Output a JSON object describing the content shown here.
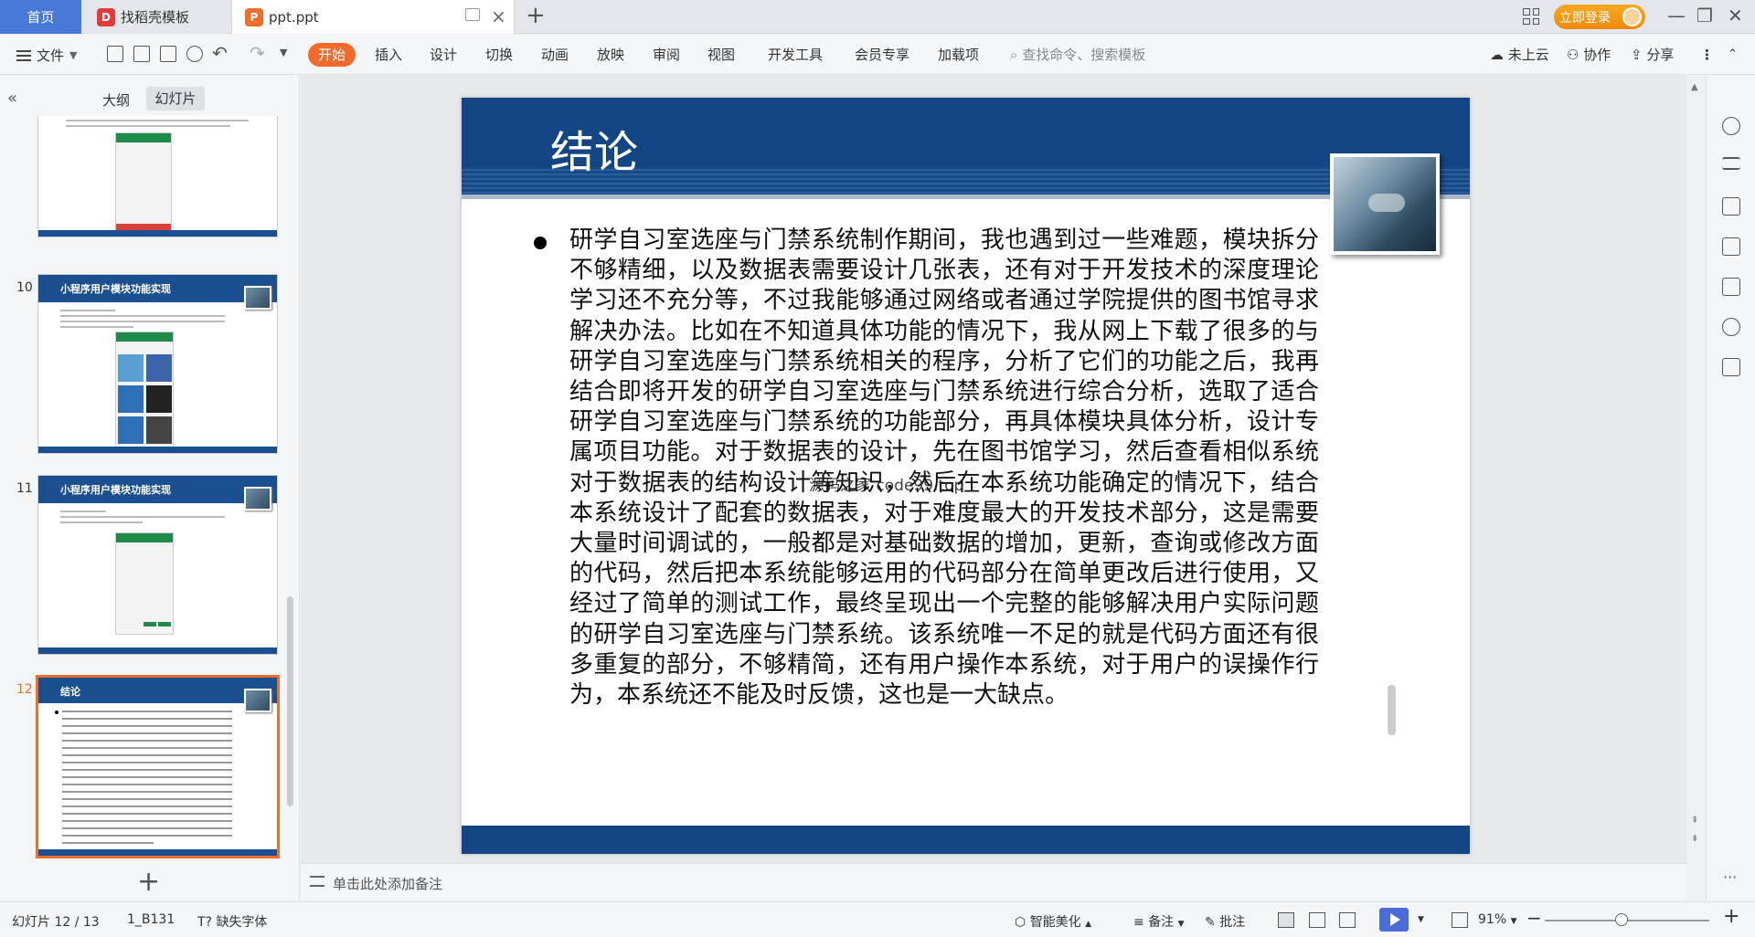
{
  "tabs": {
    "home": "首页",
    "template": "找稻壳模板",
    "document": "ppt.ppt"
  },
  "titlebar": {
    "login": "立即登录"
  },
  "toolbar": {
    "file": "文件",
    "ribbon_tabs": [
      "开始",
      "插入",
      "设计",
      "切换",
      "动画",
      "放映",
      "审阅",
      "视图",
      "开发工具",
      "会员专享",
      "加载项"
    ],
    "search_placeholder": "查找命令、搜索模板",
    "cloud": "未上云",
    "collab": "协作",
    "share": "分享"
  },
  "left_panel": {
    "tab_outline": "大纲",
    "tab_slides": "幻灯片",
    "thumbnails": [
      {
        "number": "10",
        "title": "小程序用户模块功能实现"
      },
      {
        "number": "11",
        "title": "小程序用户模块功能实现"
      },
      {
        "number": "12",
        "title": "结论"
      }
    ]
  },
  "slide": {
    "title": "结论",
    "body": "研学自习室选座与门禁系统制作期间，我也遇到过一些难题，模块拆分不够精细，以及数据表需要设计几张表，还有对于开发技术的深度理论学习还不充分等，不过我能够通过网络或者通过学院提供的图书馆寻求解决办法。比如在不知道具体功能的情况下，我从网上下载了很多的与研学自习室选座与门禁系统相关的程序，分析了它们的功能之后，我再结合即将开发的研学自习室选座与门禁系统进行综合分析，选取了适合研学自习室选座与门禁系统的功能部分，再具体模块具体分析，设计专属项目功能。对于数据表的设计，先在图书馆学习，然后查看相似系统对于数据表的结构设计等知识，然后在本系统功能确定的情况下，结合本系统设计了配套的数据表，对于难度最大的开发技术部分，这是需要大量时间调试的，一般都是对基础数据的增加，更新，查询或修改方面的代码，然后把本系统能够运用的代码部分在简单更改后进行使用，又经过了简单的测试工作，最终呈现出一个完整的能够解决用户实际问题的研学自习室选座与门禁系统。该系统唯一不足的就是代码方面还有很多重复的部分，不够精简，还有用户操作本系统，对于用户的误操作行为，本系统还不能及时反馈，这也是一大缺点。",
    "watermark": "源码之家 code99.top"
  },
  "notes": {
    "placeholder": "单击此处添加备注"
  },
  "status": {
    "slide_counter": "幻灯片 12 / 13",
    "theme": "1_B131",
    "missing_font": "缺失字体",
    "beautify": "智能美化",
    "notes": "备注",
    "comment": "批注",
    "zoom": "91%"
  },
  "colors": {
    "accent": "#f36b2b",
    "slide_blue": "#144685",
    "home_tab": "#4878d8"
  }
}
